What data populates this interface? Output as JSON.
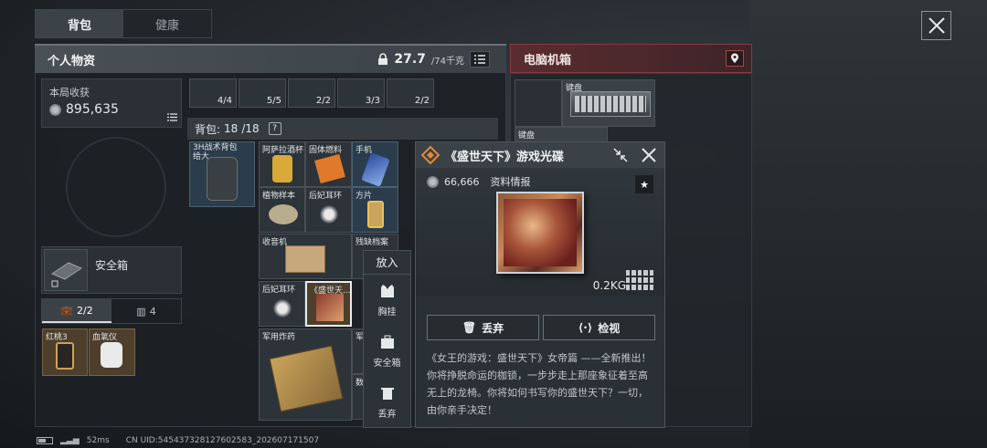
{
  "tabs": [
    {
      "label": "背包",
      "active": true
    },
    {
      "label": "健康",
      "active": false
    }
  ],
  "personal": {
    "title": "个人物资",
    "weight": "27.7",
    "weight_max": "/74千克"
  },
  "computer_box": {
    "title": "电脑机箱",
    "items": [
      {
        "name": "键盘"
      },
      {
        "name": "键盘"
      }
    ]
  },
  "earnings": {
    "label": "本局收获",
    "value": "895,635"
  },
  "top_row": [
    {
      "count": "4/4"
    },
    {
      "count": "5/5"
    },
    {
      "count": "2/2"
    },
    {
      "count": "3/3"
    },
    {
      "count": "2/2"
    }
  ],
  "backpack": {
    "label": "背包:",
    "count": "18",
    "max": "/18",
    "help": "?"
  },
  "backpack_item": {
    "name": "3H战术背包 给大..."
  },
  "items": [
    {
      "name": "阿萨拉酒杯"
    },
    {
      "name": "固体燃料"
    },
    {
      "name": "手机"
    },
    {
      "name": "植物样本"
    },
    {
      "name": "后妃耳环"
    },
    {
      "name": "方片"
    },
    {
      "name": "收音机"
    },
    {
      "name": "残缺档案"
    },
    {
      "name": "后妃耳环"
    },
    {
      "name": "《盛世天..."
    },
    {
      "name": "军用炸药"
    },
    {
      "name": "军"
    },
    {
      "name": "数"
    }
  ],
  "safe": {
    "label": "安全箱"
  },
  "subtabs": [
    {
      "label": "2/2"
    },
    {
      "label": "4"
    }
  ],
  "safe_items": [
    {
      "name": "红桃3"
    },
    {
      "name": "血氧仪"
    }
  ],
  "context_menu": {
    "header": "放入",
    "items": [
      {
        "label": "胸挂"
      },
      {
        "label": "安全箱"
      },
      {
        "label": "丢弃"
      }
    ]
  },
  "detail": {
    "title": "《盛世天下》游戏光碟",
    "price": "66,666",
    "category": "资料情报",
    "weight": "0.2KG",
    "discard": "丢弃",
    "inspect": "检视",
    "description": "《女王的游戏：盛世天下》女帝篇 ——全新推出！你将挣脱命运的枷锁，一步步走上那座象征着至高无上的龙椅。你将如何书写你的盛世天下？一切，由你亲手决定！"
  },
  "status": {
    "ping": "52ms",
    "uid": "CN UID:545437328127602583_202607171507"
  }
}
